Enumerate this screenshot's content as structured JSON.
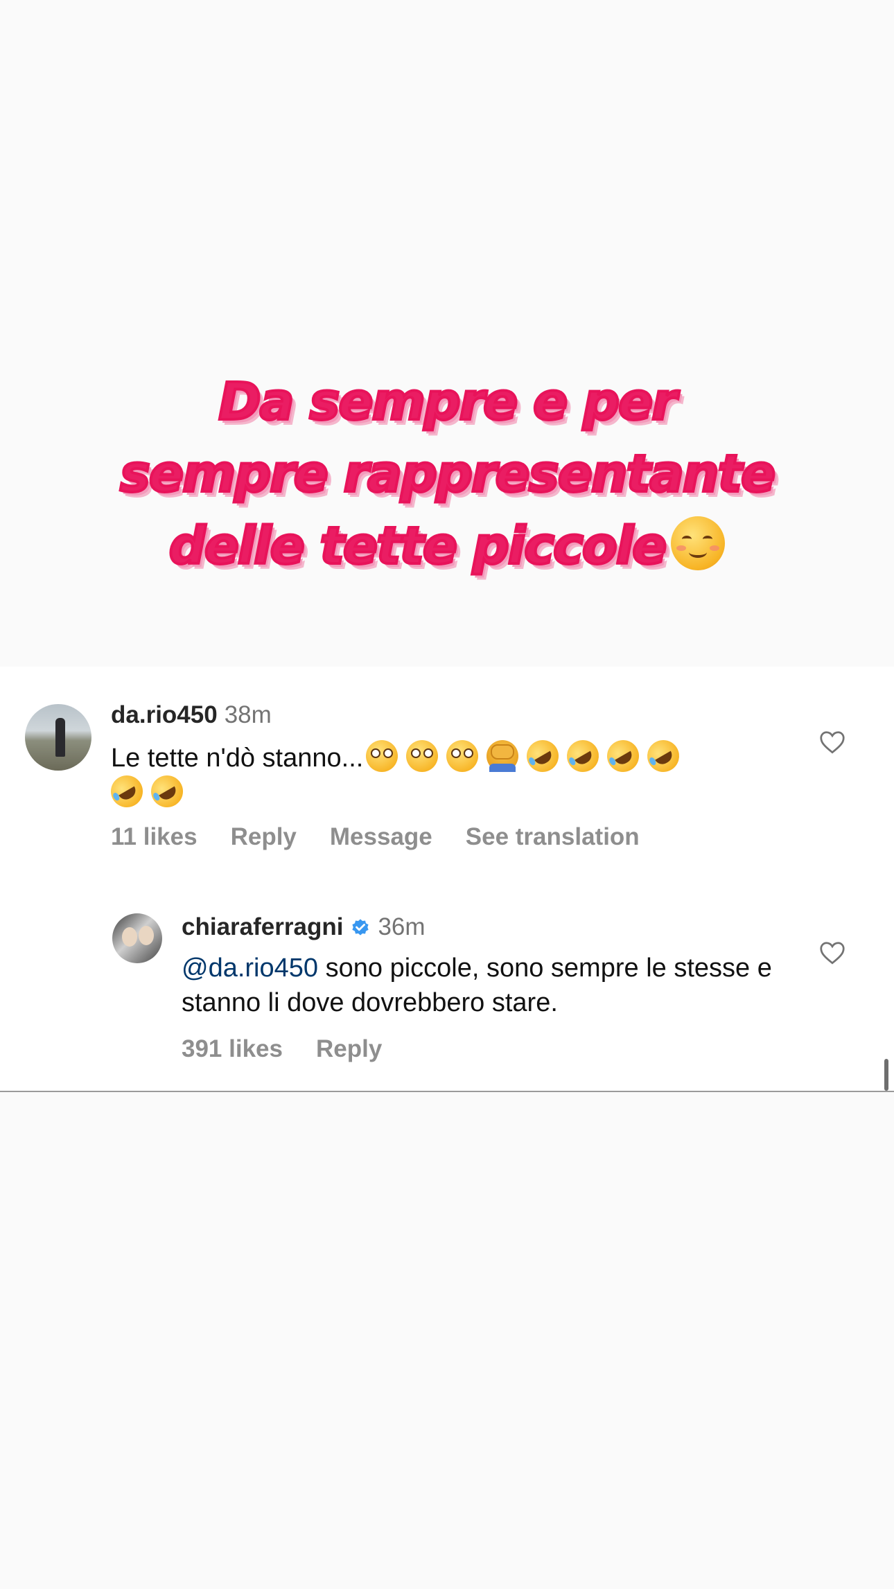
{
  "caption": {
    "lines": [
      "Da sempre e per",
      "sempre rappresentante",
      "delle tette piccole"
    ],
    "emoji": "smiling-face-icon",
    "color": "#ea1d63"
  },
  "comments": [
    {
      "username": "da.rio450",
      "time": "38m",
      "text": "Le tette n'dò stanno...",
      "emojis": [
        "flushed-face",
        "flushed-face",
        "flushed-face",
        "man-facepalming",
        "rofl",
        "rofl",
        "rofl",
        "rofl",
        "rofl",
        "rofl"
      ],
      "likes": "11 likes",
      "reply": "Reply",
      "message": "Message",
      "translate": "See translation"
    },
    {
      "username": "chiaraferragni",
      "verified": true,
      "time": "36m",
      "mention": "@da.rio450",
      "text": " sono piccole, sono sempre le stesse e stanno li dove dovrebbero stare.",
      "likes": "391 likes",
      "reply": "Reply"
    }
  ],
  "colors": {
    "mention": "#00376b",
    "muted": "#8e8e8e",
    "verified": "#3897f0"
  }
}
